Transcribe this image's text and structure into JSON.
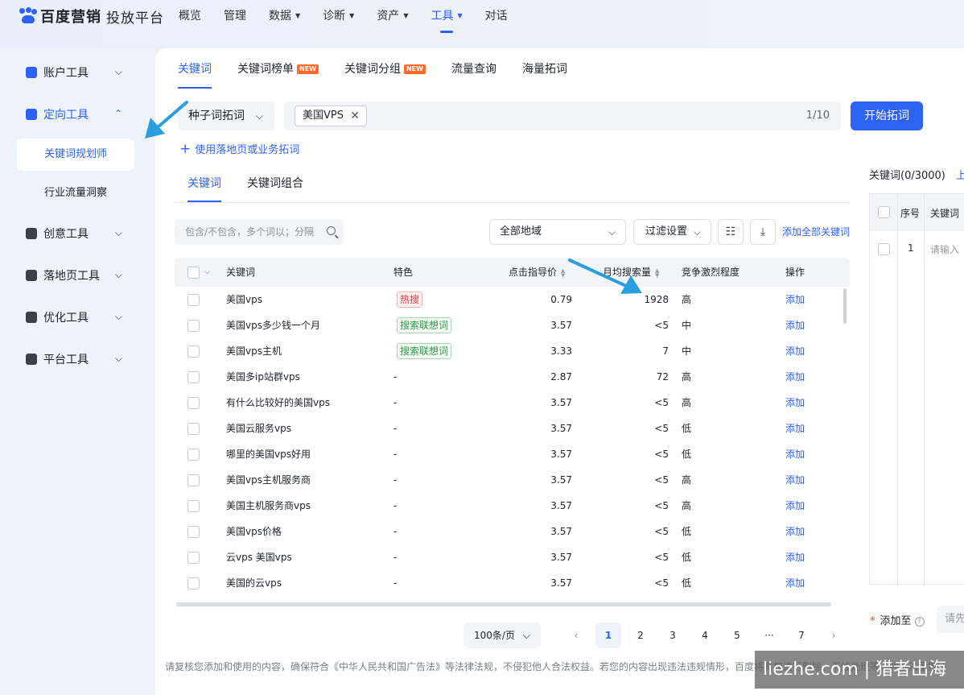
{
  "header": {
    "brand": "百度营销",
    "product": "投放平台",
    "nav": [
      {
        "label": "概览",
        "dropdown": false
      },
      {
        "label": "管理",
        "dropdown": false
      },
      {
        "label": "数据",
        "dropdown": true
      },
      {
        "label": "诊断",
        "dropdown": true
      },
      {
        "label": "资产",
        "dropdown": true
      },
      {
        "label": "工具",
        "dropdown": true,
        "active": true
      },
      {
        "label": "对话",
        "dropdown": false
      }
    ]
  },
  "sidebar": {
    "groups": [
      {
        "label": "账户工具",
        "icon": "account-icon",
        "expanded": false
      },
      {
        "label": "定向工具",
        "icon": "targeting-icon",
        "expanded": true,
        "items": [
          {
            "label": "关键词规划师",
            "active": true
          },
          {
            "label": "行业流量洞察",
            "active": false
          }
        ]
      },
      {
        "label": "创意工具",
        "icon": "image-icon",
        "expanded": false
      },
      {
        "label": "落地页工具",
        "icon": "page-icon",
        "expanded": false
      },
      {
        "label": "优化工具",
        "icon": "chart-icon",
        "expanded": false
      },
      {
        "label": "平台工具",
        "icon": "cube-icon",
        "expanded": false
      }
    ]
  },
  "main": {
    "tabs": [
      {
        "label": "关键词",
        "active": true,
        "badge": ""
      },
      {
        "label": "关键词榜单",
        "active": false,
        "badge": "NEW"
      },
      {
        "label": "关键词分组",
        "active": false,
        "badge": "NEW"
      },
      {
        "label": "流量查询",
        "active": false,
        "badge": ""
      },
      {
        "label": "海量拓词",
        "active": false,
        "badge": ""
      }
    ],
    "seed_mode": "种子词拓词",
    "seed_tag": "美国VPS",
    "seed_count": "1/10",
    "start_button": "开始拓词",
    "landing_link": "使用落地页或业务拓词",
    "subtabs": [
      "关键词",
      "关键词组合"
    ],
    "filter_placeholder": "包含/不包含，多个词以；分隔",
    "region": "全部地域",
    "filter_settings": "过滤设置",
    "add_all": "添加全部关键词",
    "columns": {
      "keyword": "关键词",
      "feature": "特色",
      "bid": "点击指导价",
      "volume": "月均搜索量",
      "competition": "竞争激烈程度",
      "action": "操作"
    },
    "rows": [
      {
        "keyword": "美国vps",
        "feature": "热搜",
        "feature_type": "hot",
        "bid": "0.79",
        "volume": "1928",
        "competition": "高",
        "action": "添加"
      },
      {
        "keyword": "美国vps多少钱一个月",
        "feature": "搜索联想词",
        "feature_type": "suggest",
        "bid": "3.57",
        "volume": "<5",
        "competition": "中",
        "action": "添加"
      },
      {
        "keyword": "美国vps主机",
        "feature": "搜索联想词",
        "feature_type": "suggest",
        "bid": "3.33",
        "volume": "7",
        "competition": "中",
        "action": "添加"
      },
      {
        "keyword": "美国多ip站群vps",
        "feature": "-",
        "feature_type": "none",
        "bid": "2.87",
        "volume": "72",
        "competition": "高",
        "action": "添加"
      },
      {
        "keyword": "有什么比较好的美国vps",
        "feature": "-",
        "feature_type": "none",
        "bid": "3.57",
        "volume": "<5",
        "competition": "高",
        "action": "添加"
      },
      {
        "keyword": "美国云服务vps",
        "feature": "-",
        "feature_type": "none",
        "bid": "3.57",
        "volume": "<5",
        "competition": "低",
        "action": "添加"
      },
      {
        "keyword": "哪里的美国vps好用",
        "feature": "-",
        "feature_type": "none",
        "bid": "3.57",
        "volume": "<5",
        "competition": "低",
        "action": "添加"
      },
      {
        "keyword": "美国vps主机服务商",
        "feature": "-",
        "feature_type": "none",
        "bid": "3.57",
        "volume": "<5",
        "competition": "高",
        "action": "添加"
      },
      {
        "keyword": "美国主机服务商vps",
        "feature": "-",
        "feature_type": "none",
        "bid": "3.57",
        "volume": "<5",
        "competition": "高",
        "action": "添加"
      },
      {
        "keyword": "美国vps价格",
        "feature": "-",
        "feature_type": "none",
        "bid": "3.57",
        "volume": "<5",
        "competition": "低",
        "action": "添加"
      },
      {
        "keyword": "云vps 美国vps",
        "feature": "-",
        "feature_type": "none",
        "bid": "3.57",
        "volume": "<5",
        "competition": "低",
        "action": "添加"
      },
      {
        "keyword": "美国的云vps",
        "feature": "-",
        "feature_type": "none",
        "bid": "3.57",
        "volume": "<5",
        "competition": "低",
        "action": "添加"
      }
    ],
    "pagination": {
      "page_size": "100条/页",
      "pages": [
        "1",
        "2",
        "3",
        "4",
        "5",
        "···",
        "7"
      ],
      "current": "1",
      "prev": "‹",
      "next": "›"
    },
    "disclaimer": "请复核您添加和使用的内容，确保符合《中华人民共和国广告法》等法律法规，不侵犯他人合法权益。若您的内容出现违法违规情形，百度将有权进行删除、下线处理等，并依法承担"
  },
  "right_panel": {
    "title": "关键词(0/3000)",
    "more": "上",
    "col_index": "序号",
    "col_keyword": "关键词",
    "row_index": "1",
    "row_placeholder": "请输入",
    "add_to_label": "添加至",
    "add_to_placeholder": "请先"
  },
  "watermark": "liezhe.com | 猎者出海",
  "colors": {
    "accent": "#2c63f5",
    "hot": "#e43d3d",
    "suggest": "#2e9d47",
    "badge_new": "#ff6a2b",
    "annotation_arrow": "#2a9fe0"
  }
}
